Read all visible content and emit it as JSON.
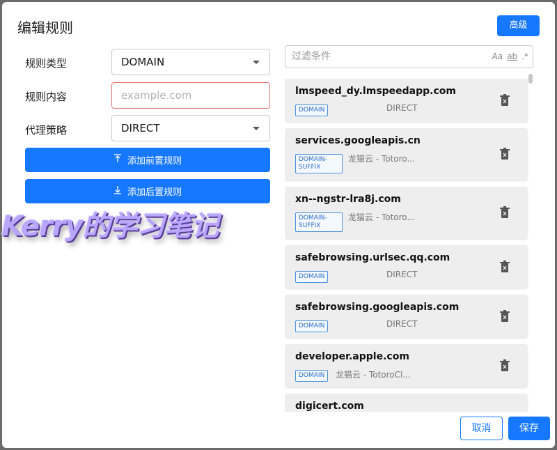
{
  "dialog": {
    "title": "编辑规则",
    "advanced_label": "高级",
    "cancel_label": "取消",
    "save_label": "保存"
  },
  "form": {
    "type_label": "规则类型",
    "type_value": "DOMAIN",
    "content_label": "规则内容",
    "content_placeholder": "example.com",
    "policy_label": "代理策略",
    "policy_value": "DIRECT",
    "add_prepend_label": "添加前置规则",
    "add_append_label": "添加后置规则"
  },
  "watermark": "Kerry的学习笔记",
  "filter": {
    "placeholder": "过滤条件",
    "opt_case": "Aa",
    "opt_word": "ab",
    "opt_regex": ".*"
  },
  "rules": [
    {
      "host": "lmspeed_dy.lmspeedapp.com",
      "type": "DOMAIN",
      "type2": "",
      "proxy": "DIRECT"
    },
    {
      "host": "services.googleapis.cn",
      "type": "DOMAIN-",
      "type2": "SUFFIX",
      "proxy": "龙猫云 - Totoro..."
    },
    {
      "host": "xn--ngstr-lra8j.com",
      "type": "DOMAIN-",
      "type2": "SUFFIX",
      "proxy": "龙猫云 - Totoro..."
    },
    {
      "host": "safebrowsing.urlsec.qq.com",
      "type": "DOMAIN",
      "type2": "",
      "proxy": "DIRECT"
    },
    {
      "host": "safebrowsing.googleapis.com",
      "type": "DOMAIN",
      "type2": "",
      "proxy": "DIRECT"
    },
    {
      "host": "developer.apple.com",
      "type": "DOMAIN",
      "type2": "",
      "proxy": "龙猫云 - TotoroCl..."
    },
    {
      "host": "digicert.com",
      "type": "",
      "type2": "",
      "proxy": ""
    }
  ],
  "colors": {
    "accent": "#1677ff",
    "error_border": "#e57373",
    "card_bg": "#eeeeee"
  }
}
